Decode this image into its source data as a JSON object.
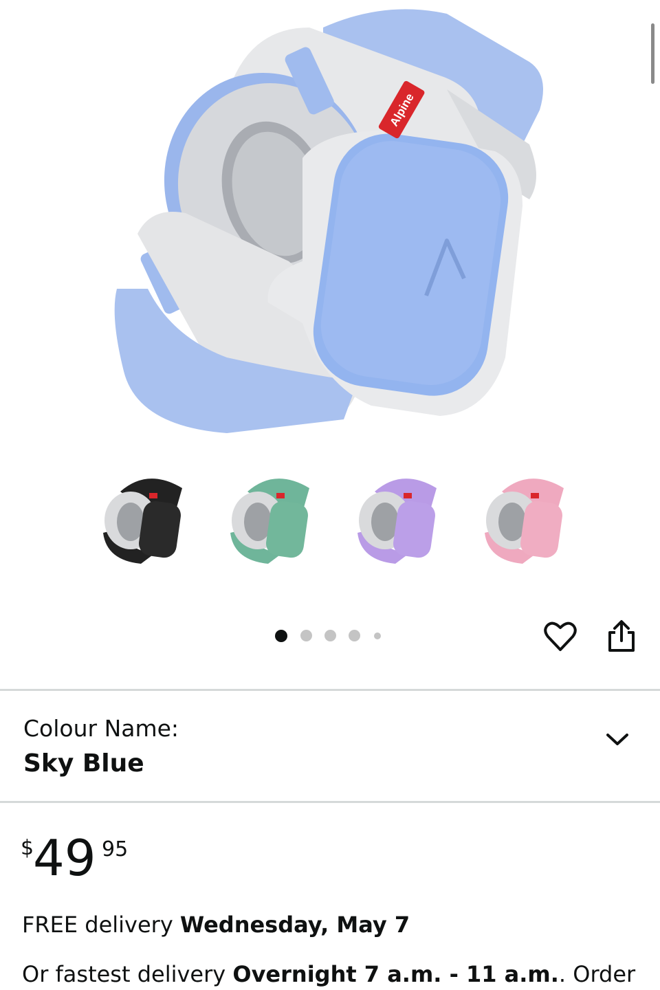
{
  "product": {
    "brand_tag": "Alpine",
    "colour_label": "Colour Name:",
    "colour_value": "Sky Blue",
    "variants": [
      {
        "name": "black",
        "color": "#2a2a2a"
      },
      {
        "name": "green",
        "color": "#6fb59a"
      },
      {
        "name": "purple",
        "color": "#b99be6"
      },
      {
        "name": "pink",
        "color": "#efa9bf"
      }
    ],
    "gallery": {
      "total_images": 5,
      "active_index": 0
    },
    "accent_color": "#8fb0ee"
  },
  "price": {
    "currency": "$",
    "whole": "49",
    "fraction": "95"
  },
  "delivery": {
    "free_prefix": "FREE delivery ",
    "free_date": "Wednesday, May 7",
    "fast_prefix": "Or fastest delivery ",
    "fast_window": "Overnight 7 a.m. - 11 a.m.",
    "fast_suffix": ". Order"
  },
  "icons": {
    "wishlist": "heart-icon",
    "share": "share-icon",
    "expand": "chevron-down-icon"
  }
}
